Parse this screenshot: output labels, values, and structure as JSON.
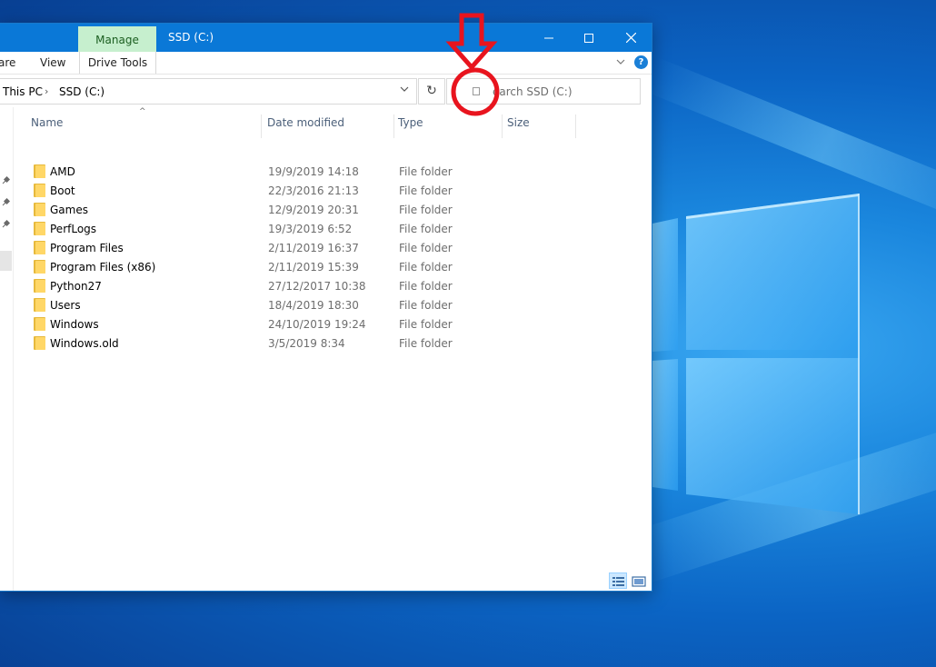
{
  "window": {
    "ribbon_context_tab": "Manage",
    "title": "SSD (C:)",
    "ribbon_tabs": [
      "are",
      "View",
      "Drive Tools"
    ]
  },
  "address": {
    "crumbs": [
      "This PC",
      "SSD (C:)"
    ],
    "search_placeholder": "earch SSD (C:)"
  },
  "columns": {
    "name": "Name",
    "date": "Date modified",
    "type": "Type",
    "size": "Size"
  },
  "files": [
    {
      "name": "AMD",
      "date": "19/9/2019 14:18",
      "type": "File folder"
    },
    {
      "name": "Boot",
      "date": "22/3/2016 21:13",
      "type": "File folder"
    },
    {
      "name": "Games",
      "date": "12/9/2019 20:31",
      "type": "File folder"
    },
    {
      "name": "PerfLogs",
      "date": "19/3/2019 6:52",
      "type": "File folder"
    },
    {
      "name": "Program Files",
      "date": "2/11/2019 16:37",
      "type": "File folder"
    },
    {
      "name": "Program Files (x86)",
      "date": "2/11/2019 15:39",
      "type": "File folder"
    },
    {
      "name": "Python27",
      "date": "27/12/2017 10:38",
      "type": "File folder"
    },
    {
      "name": "Users",
      "date": "18/4/2019 18:30",
      "type": "File folder"
    },
    {
      "name": "Windows",
      "date": "24/10/2019 19:24",
      "type": "File folder"
    },
    {
      "name": "Windows.old",
      "date": "3/5/2019 8:34",
      "type": "File folder"
    }
  ],
  "icons": {
    "help": "?",
    "refresh": "↻",
    "sort": "^",
    "breadcrumb_separator": "›"
  },
  "colors": {
    "titlebar": "#0a78d7",
    "manage_tab": "#c6efce",
    "annotation": "#e8141e",
    "folder": "#ffd767"
  }
}
